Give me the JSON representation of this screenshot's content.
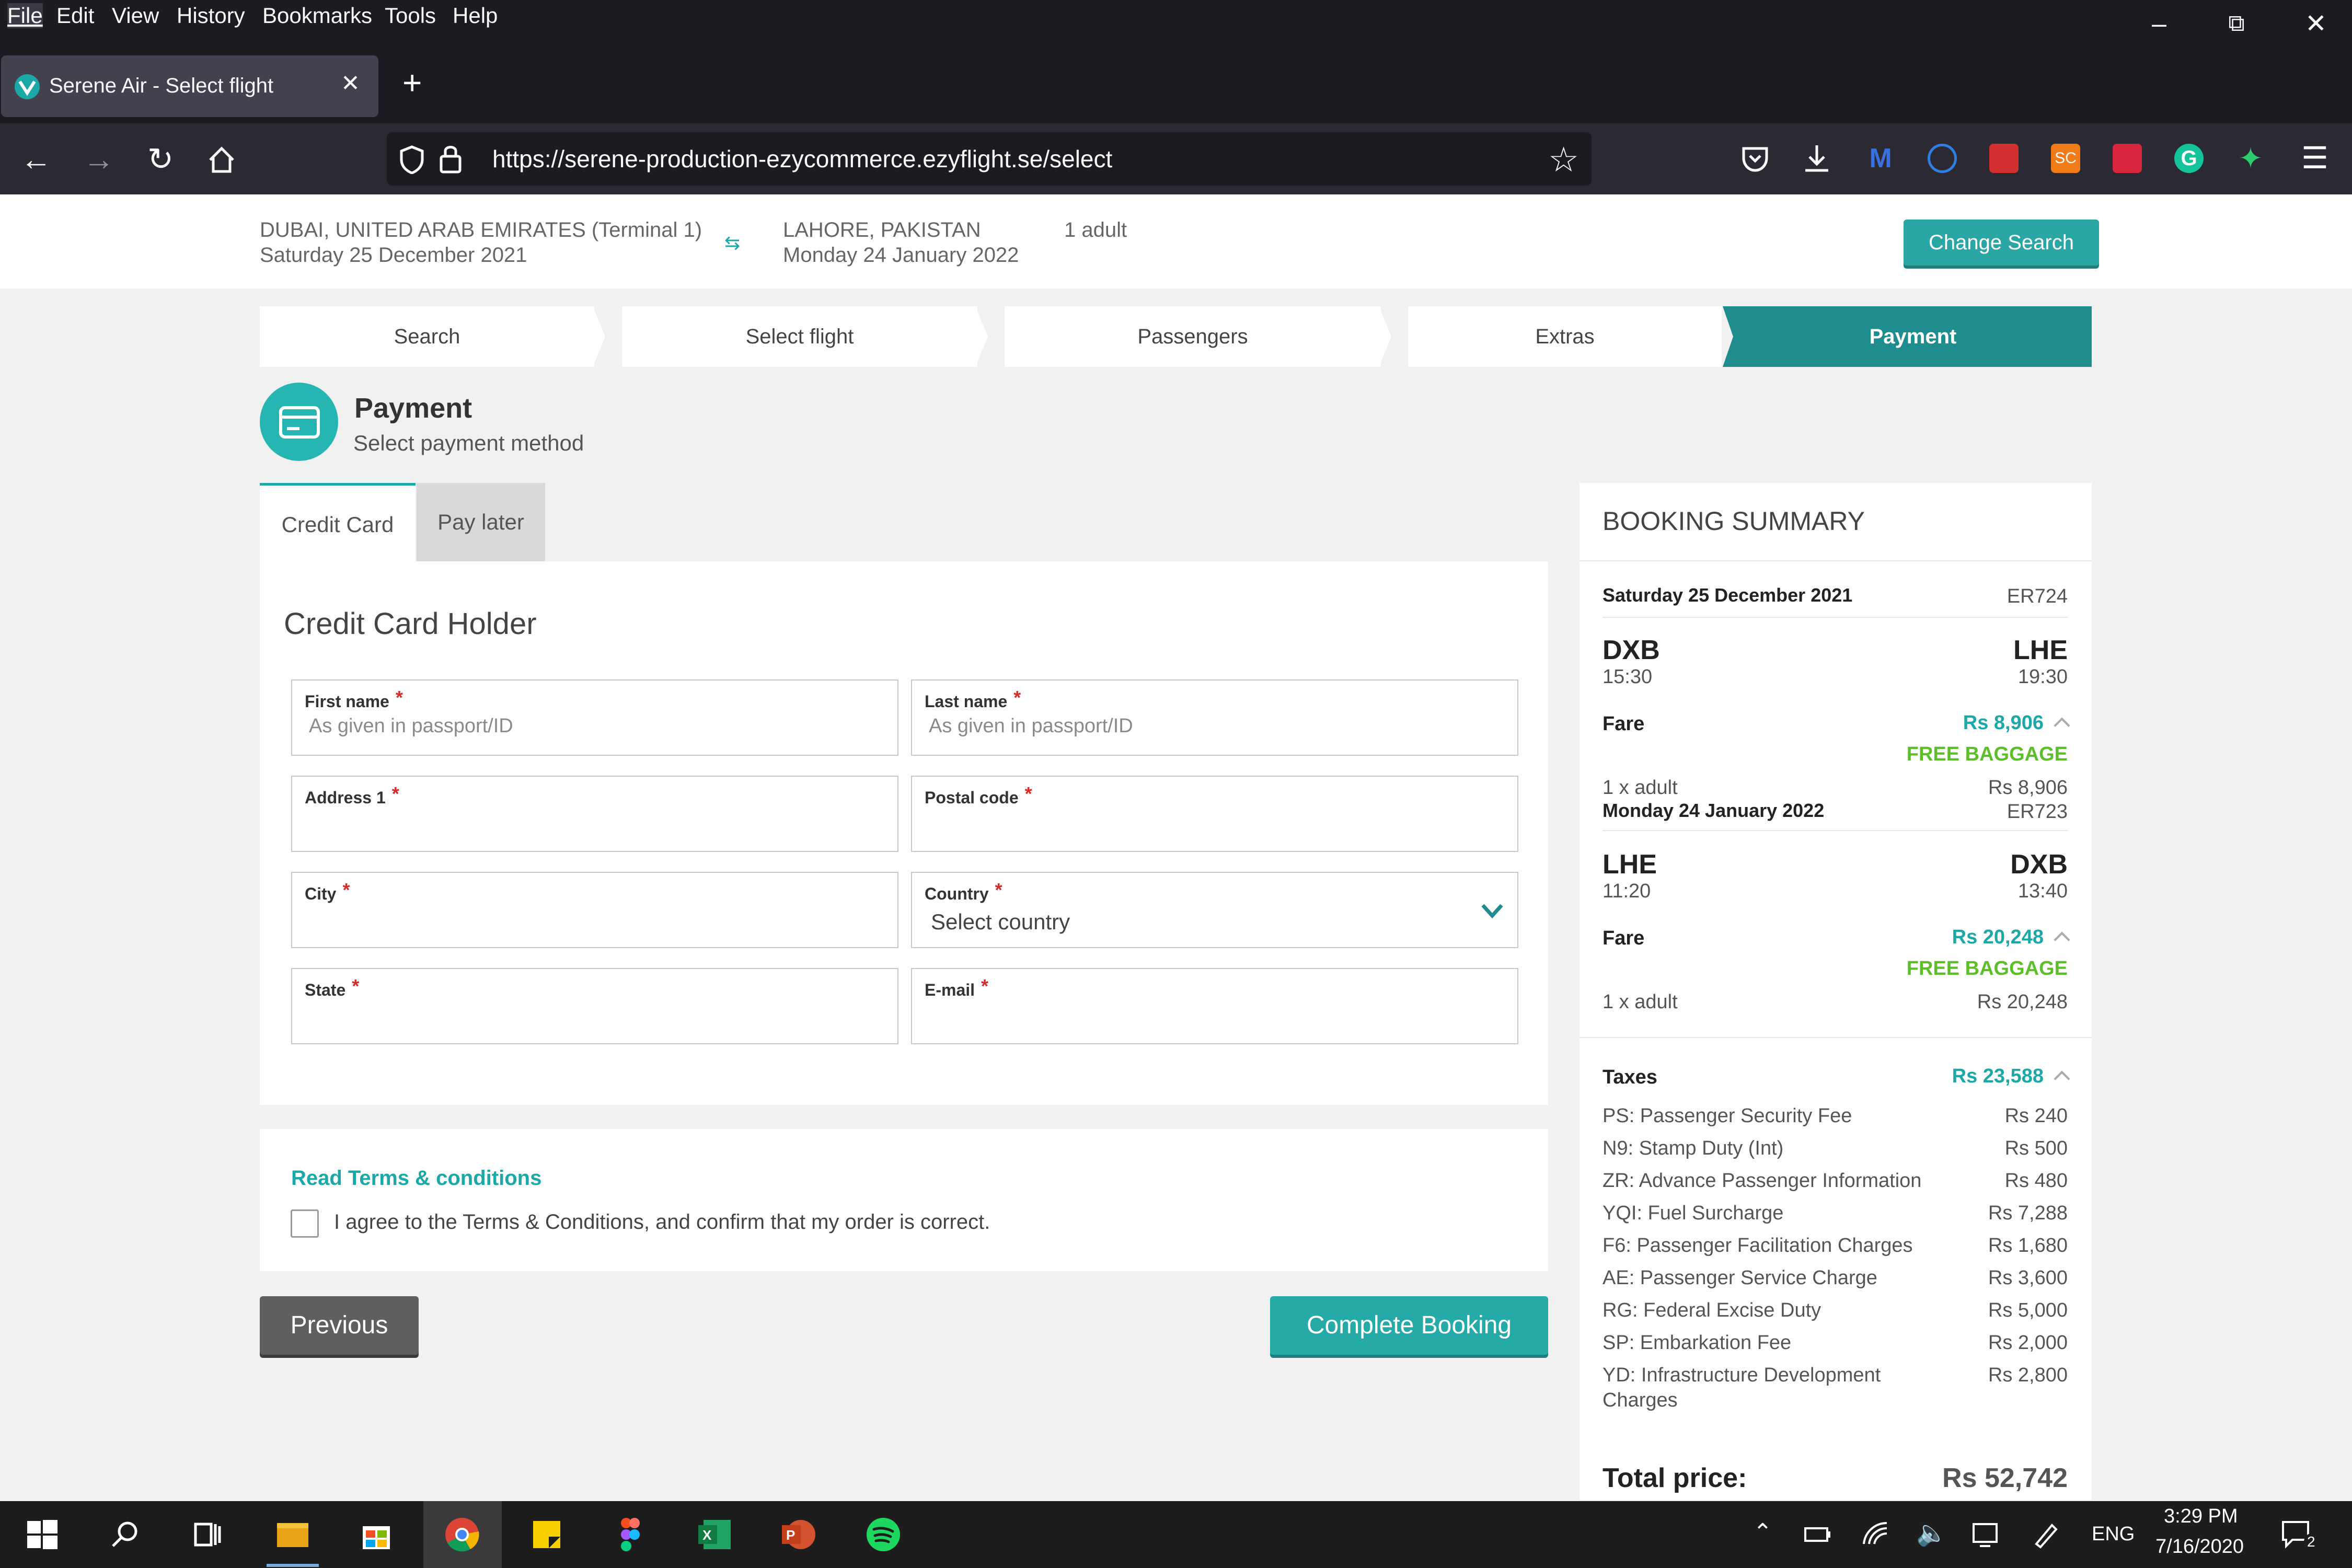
{
  "menu": [
    "File",
    "Edit",
    "View",
    "History",
    "Bookmarks",
    "Tools",
    "Help"
  ],
  "browser": {
    "tab_title": "Serene Air - Select flight",
    "url": "https://serene-production-ezycommerce.ezyflight.se/select"
  },
  "trip": {
    "origin": "DUBAI, UNITED ARAB EMIRATES (Terminal 1)",
    "origin_date": "Saturday 25 December 2021",
    "destination": "LAHORE, PAKISTAN",
    "destination_date": "Monday 24 January 2022",
    "passengers": "1 adult",
    "change_search": "Change Search"
  },
  "steps": [
    "Search",
    "Select flight",
    "Passengers",
    "Extras",
    "Payment"
  ],
  "payment": {
    "title": "Payment",
    "subtitle": "Select payment method",
    "tabs": [
      "Credit Card",
      "Pay later"
    ],
    "section_title": "Credit Card Holder",
    "fields": {
      "first_name": {
        "label": "First name",
        "placeholder": "As given in passport/ID"
      },
      "last_name": {
        "label": "Last name",
        "placeholder": "As given in passport/ID"
      },
      "address1": {
        "label": "Address 1"
      },
      "postal_code": {
        "label": "Postal code"
      },
      "city": {
        "label": "City"
      },
      "country": {
        "label": "Country",
        "value": "Select country"
      },
      "state": {
        "label": "State"
      },
      "email": {
        "label": "E-mail"
      }
    },
    "required_mark": "*",
    "terms_link": "Read Terms & conditions",
    "terms_text": "I agree to the Terms & Conditions, and confirm that my order is correct.",
    "previous": "Previous",
    "complete": "Complete Booking"
  },
  "summary": {
    "title": "BOOKING SUMMARY",
    "outbound": {
      "date": "Saturday 25 December 2021",
      "flight": "ER724",
      "from": "DXB",
      "from_time": "15:30",
      "to": "LHE",
      "to_time": "19:30",
      "fare_label": "Fare",
      "fare": "Rs 8,906",
      "baggage": "FREE BAGGAGE",
      "pax": "1 x adult",
      "pax_price": "Rs 8,906"
    },
    "inbound": {
      "date": "Monday 24 January 2022",
      "flight": "ER723",
      "from": "LHE",
      "from_time": "11:20",
      "to": "DXB",
      "to_time": "13:40",
      "fare_label": "Fare",
      "fare": "Rs 20,248",
      "baggage": "FREE BAGGAGE",
      "pax": "1 x adult",
      "pax_price": "Rs 20,248"
    },
    "taxes_label": "Taxes",
    "taxes_total": "Rs 23,588",
    "taxes": [
      {
        "name": "PS: Passenger Security Fee",
        "amount": "Rs 240"
      },
      {
        "name": "N9: Stamp Duty (Int)",
        "amount": "Rs 500"
      },
      {
        "name": "ZR: Advance Passenger Information",
        "amount": "Rs 480"
      },
      {
        "name": "YQI: Fuel Surcharge",
        "amount": "Rs 7,288"
      },
      {
        "name": "F6: Passenger Facilitation Charges",
        "amount": "Rs 1,680"
      },
      {
        "name": "AE: Passenger Service Charge",
        "amount": "Rs 3,600"
      },
      {
        "name": "RG: Federal Excise Duty",
        "amount": "Rs 5,000"
      },
      {
        "name": "SP: Embarkation Fee",
        "amount": "Rs 2,000"
      },
      {
        "name": "YD: Infrastructure Development",
        "name2": "Charges",
        "amount": "Rs 2,800"
      }
    ],
    "total_label": "Total price:",
    "total": "Rs 52,742"
  },
  "taskbar": {
    "language": "ENG",
    "time": "3:29 PM",
    "date": "7/16/2020",
    "notifications": "2"
  },
  "colors": {
    "accent": "#26aaa8",
    "step_active": "#1f8c8d",
    "baggage": "#5cbf2a",
    "required": "#d62b2b"
  }
}
